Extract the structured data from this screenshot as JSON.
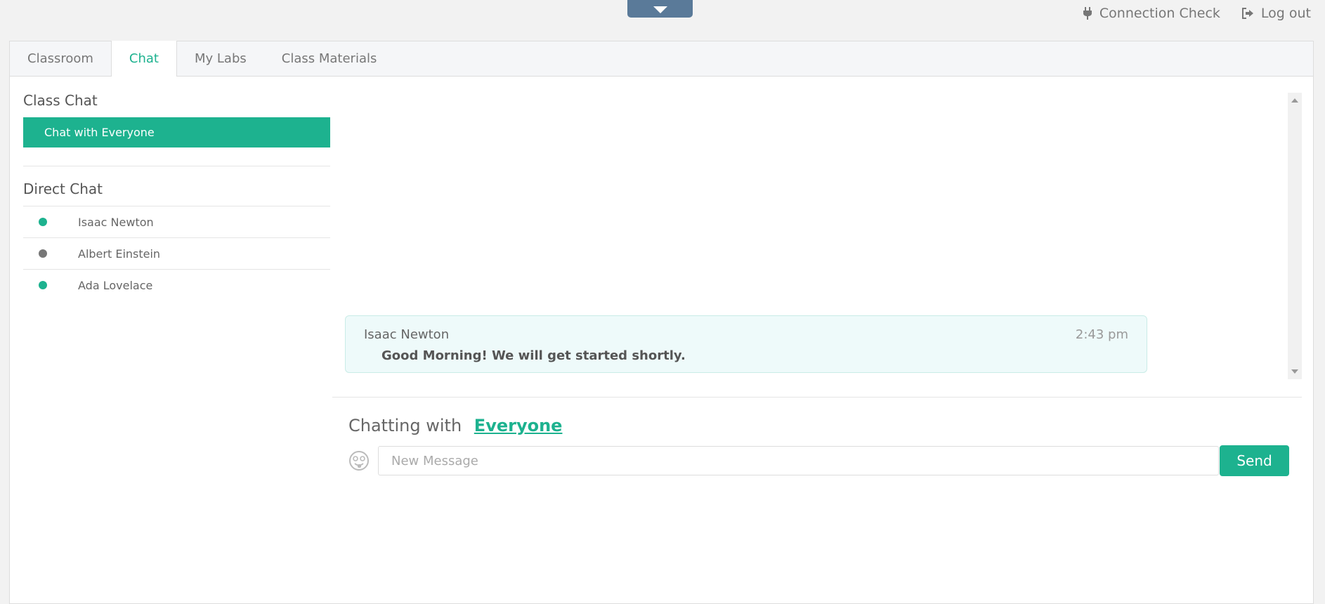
{
  "header": {
    "connection_check": "Connection Check",
    "logout": "Log out"
  },
  "tabs": [
    {
      "label": "Classroom",
      "active": false
    },
    {
      "label": "Chat",
      "active": true
    },
    {
      "label": "My Labs",
      "active": false
    },
    {
      "label": "Class Materials",
      "active": false
    }
  ],
  "sidebar": {
    "class_chat_title": "Class Chat",
    "class_chat_item": "Chat with Everyone",
    "direct_chat_title": "Direct Chat",
    "users": [
      {
        "name": "Isaac Newton",
        "status_color": "#1db28f"
      },
      {
        "name": "Albert Einstein",
        "status_color": "#777777"
      },
      {
        "name": "Ada Lovelace",
        "status_color": "#1db28f"
      }
    ]
  },
  "chat": {
    "messages": [
      {
        "sender": "Isaac Newton",
        "time": "2:43 pm",
        "text": "Good Morning! We will get started shortly."
      }
    ],
    "chatting_with_prefix": "Chatting with",
    "chatting_with_target": "Everyone",
    "input_placeholder": "New Message",
    "send_label": "Send"
  },
  "colors": {
    "accent": "#1db28f",
    "toggle_tab": "#5a7a99"
  }
}
